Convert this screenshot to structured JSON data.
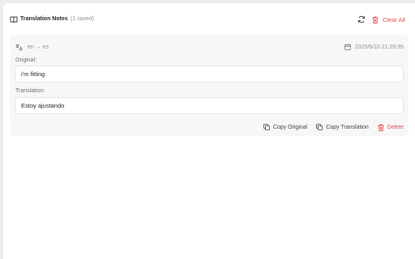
{
  "header": {
    "title": "Translation Notes",
    "count": "(1 saved)",
    "clear_label": "Clear All"
  },
  "note": {
    "lang_pair": "en → es",
    "timestamp": "2025/6/10 21:29:35",
    "original_label": "Original:",
    "original_text": "i'm fitting",
    "translation_label": "Translation:",
    "translation_text": "Estoy ajustando",
    "copy_original_label": "Copy Original",
    "copy_translation_label": "Copy Translation",
    "delete_label": "Delete"
  },
  "colors": {
    "danger": "#e5484d",
    "muted": "#8a8f99",
    "card_bg": "#f7f7f8"
  },
  "icons": [
    "book-icon",
    "refresh-icon",
    "trash-icon",
    "translate-icon",
    "calendar-icon",
    "copy-icon"
  ]
}
